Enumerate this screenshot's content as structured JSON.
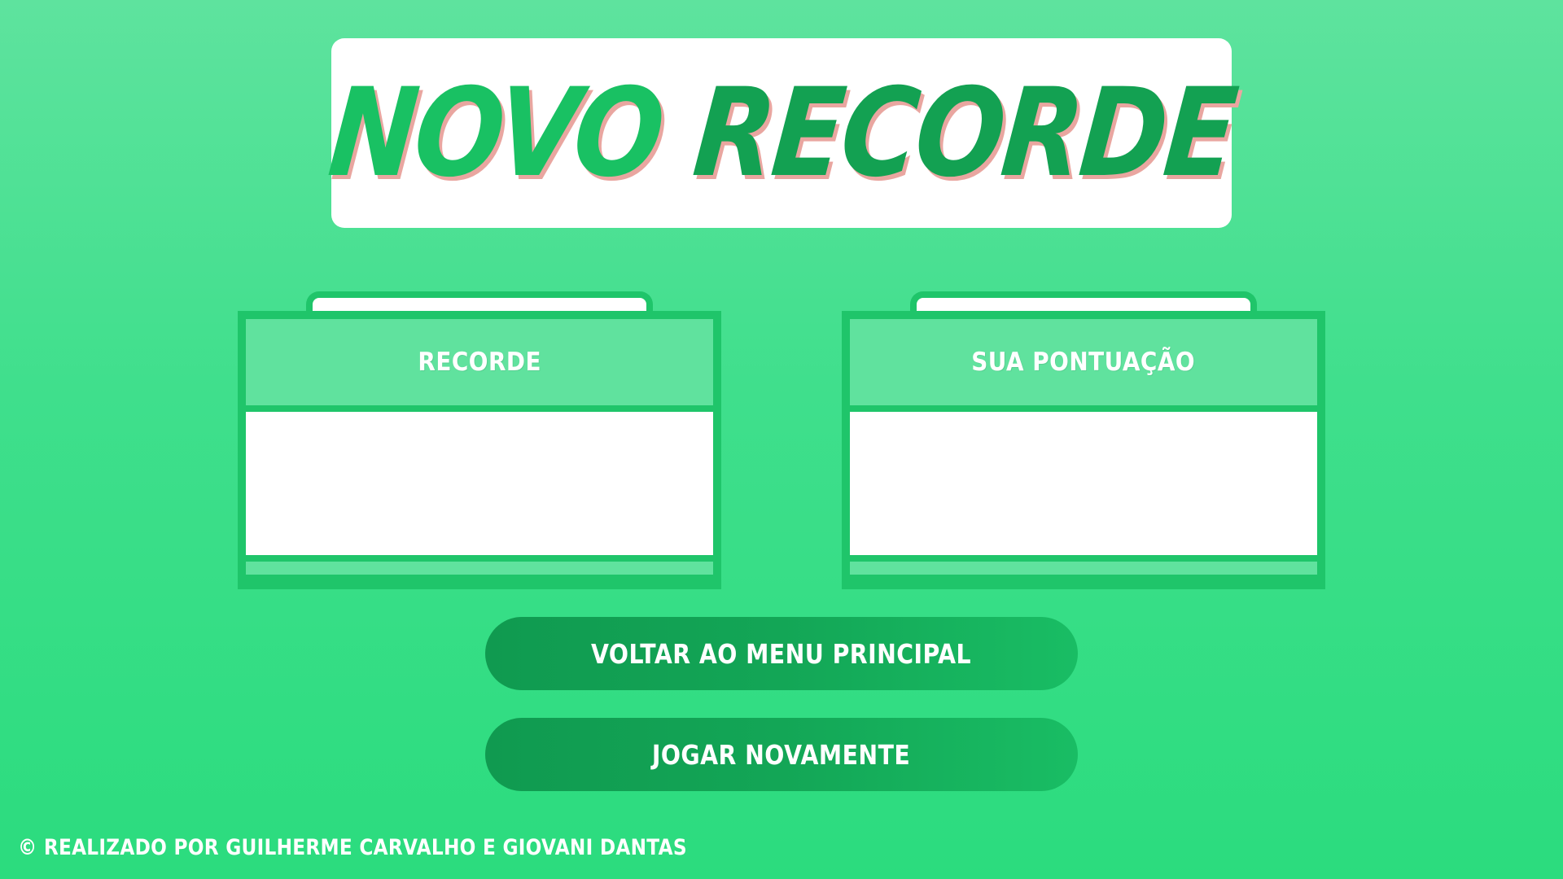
{
  "title": {
    "word_1": "NOVO",
    "word_2": "RECORDE"
  },
  "panels": {
    "record": {
      "label": "RECORDE",
      "value": ""
    },
    "score": {
      "label": "SUA PONTUAÇÃO",
      "value": ""
    }
  },
  "buttons": {
    "main_menu": "VOLTAR AO MENU PRINCIPAL",
    "play_again": "JOGAR NOVAMENTE"
  },
  "footer": {
    "credits": "© REALIZADO POR GUILHERME CARVALHO E GIOVANI DANTAS"
  },
  "colors": {
    "background_top": "#5ee39e",
    "background_bottom": "#2bdc7e",
    "title_light_green": "#19c163",
    "title_dark_green": "#13a152",
    "title_shadow": "#e9a6a0",
    "panel_border": "#1fc56a",
    "panel_header": "#60e29e",
    "button_dark": "#109a50",
    "button_light": "#19bd64"
  }
}
